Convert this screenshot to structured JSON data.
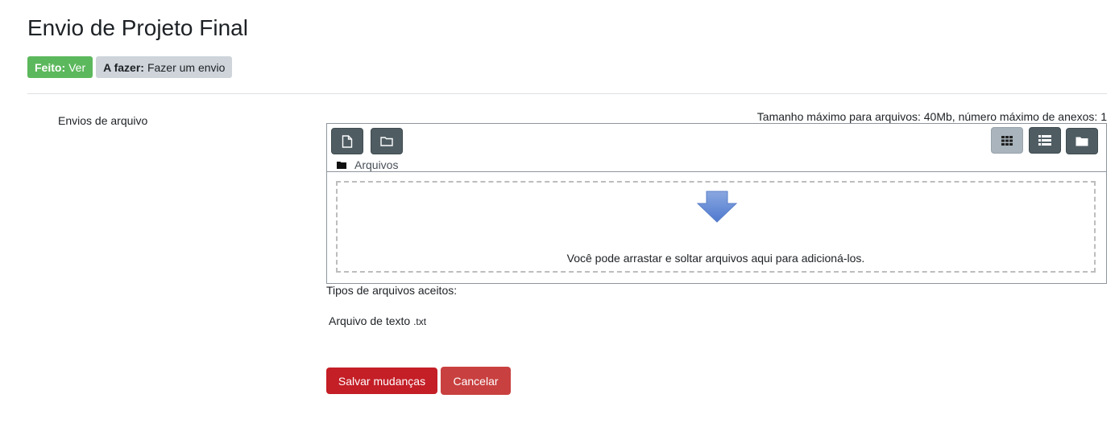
{
  "page": {
    "title": "Envio de Projeto Final"
  },
  "badges": {
    "done_label": "Feito:",
    "done_value": "Ver",
    "todo_label": "A fazer:",
    "todo_value": "Fazer um envio"
  },
  "form": {
    "field_label": "Envios de arquivo",
    "limits": "Tamanho máximo para arquivos: 40Mb, número máximo de anexos: 1",
    "path_label": "Arquivos",
    "drop_text": "Você pode arrastar e soltar arquivos aqui para adicioná-los.",
    "types_label": "Tipos de arquivos aceitos:",
    "type_name": "Arquivo de texto",
    "type_ext": ".txt"
  },
  "icons": {
    "add_file": "file-icon",
    "create_folder": "folder-icon",
    "view_icons": "grid-icon",
    "view_list": "list-icon",
    "view_tree": "folder-icon",
    "drop": "down-arrow-icon"
  },
  "colors": {
    "done_badge": "#5cb85c",
    "todo_badge": "#ced4da",
    "toolbar_button": "#4f5d63",
    "save_button": "#c41e26",
    "cancel_button": "#c8403f"
  },
  "buttons": {
    "save": "Salvar mudanças",
    "cancel": "Cancelar"
  }
}
